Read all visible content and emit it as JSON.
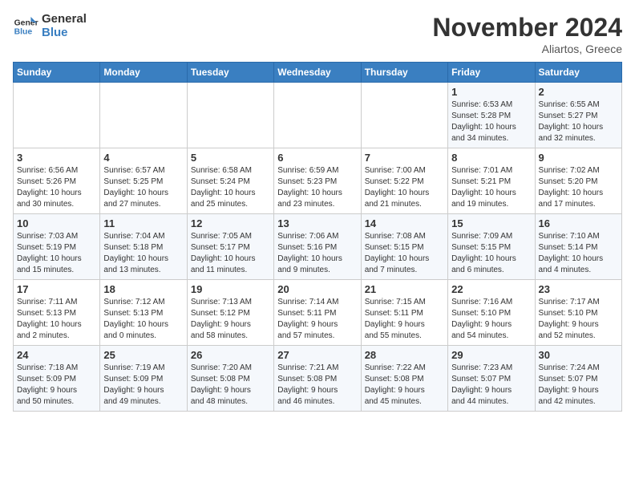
{
  "logo": {
    "line1": "General",
    "line2": "Blue"
  },
  "title": "November 2024",
  "subtitle": "Aliartos, Greece",
  "days_of_week": [
    "Sunday",
    "Monday",
    "Tuesday",
    "Wednesday",
    "Thursday",
    "Friday",
    "Saturday"
  ],
  "weeks": [
    [
      {
        "day": "",
        "info": ""
      },
      {
        "day": "",
        "info": ""
      },
      {
        "day": "",
        "info": ""
      },
      {
        "day": "",
        "info": ""
      },
      {
        "day": "",
        "info": ""
      },
      {
        "day": "1",
        "info": "Sunrise: 6:53 AM\nSunset: 5:28 PM\nDaylight: 10 hours\nand 34 minutes."
      },
      {
        "day": "2",
        "info": "Sunrise: 6:55 AM\nSunset: 5:27 PM\nDaylight: 10 hours\nand 32 minutes."
      }
    ],
    [
      {
        "day": "3",
        "info": "Sunrise: 6:56 AM\nSunset: 5:26 PM\nDaylight: 10 hours\nand 30 minutes."
      },
      {
        "day": "4",
        "info": "Sunrise: 6:57 AM\nSunset: 5:25 PM\nDaylight: 10 hours\nand 27 minutes."
      },
      {
        "day": "5",
        "info": "Sunrise: 6:58 AM\nSunset: 5:24 PM\nDaylight: 10 hours\nand 25 minutes."
      },
      {
        "day": "6",
        "info": "Sunrise: 6:59 AM\nSunset: 5:23 PM\nDaylight: 10 hours\nand 23 minutes."
      },
      {
        "day": "7",
        "info": "Sunrise: 7:00 AM\nSunset: 5:22 PM\nDaylight: 10 hours\nand 21 minutes."
      },
      {
        "day": "8",
        "info": "Sunrise: 7:01 AM\nSunset: 5:21 PM\nDaylight: 10 hours\nand 19 minutes."
      },
      {
        "day": "9",
        "info": "Sunrise: 7:02 AM\nSunset: 5:20 PM\nDaylight: 10 hours\nand 17 minutes."
      }
    ],
    [
      {
        "day": "10",
        "info": "Sunrise: 7:03 AM\nSunset: 5:19 PM\nDaylight: 10 hours\nand 15 minutes."
      },
      {
        "day": "11",
        "info": "Sunrise: 7:04 AM\nSunset: 5:18 PM\nDaylight: 10 hours\nand 13 minutes."
      },
      {
        "day": "12",
        "info": "Sunrise: 7:05 AM\nSunset: 5:17 PM\nDaylight: 10 hours\nand 11 minutes."
      },
      {
        "day": "13",
        "info": "Sunrise: 7:06 AM\nSunset: 5:16 PM\nDaylight: 10 hours\nand 9 minutes."
      },
      {
        "day": "14",
        "info": "Sunrise: 7:08 AM\nSunset: 5:15 PM\nDaylight: 10 hours\nand 7 minutes."
      },
      {
        "day": "15",
        "info": "Sunrise: 7:09 AM\nSunset: 5:15 PM\nDaylight: 10 hours\nand 6 minutes."
      },
      {
        "day": "16",
        "info": "Sunrise: 7:10 AM\nSunset: 5:14 PM\nDaylight: 10 hours\nand 4 minutes."
      }
    ],
    [
      {
        "day": "17",
        "info": "Sunrise: 7:11 AM\nSunset: 5:13 PM\nDaylight: 10 hours\nand 2 minutes."
      },
      {
        "day": "18",
        "info": "Sunrise: 7:12 AM\nSunset: 5:13 PM\nDaylight: 10 hours\nand 0 minutes."
      },
      {
        "day": "19",
        "info": "Sunrise: 7:13 AM\nSunset: 5:12 PM\nDaylight: 9 hours\nand 58 minutes."
      },
      {
        "day": "20",
        "info": "Sunrise: 7:14 AM\nSunset: 5:11 PM\nDaylight: 9 hours\nand 57 minutes."
      },
      {
        "day": "21",
        "info": "Sunrise: 7:15 AM\nSunset: 5:11 PM\nDaylight: 9 hours\nand 55 minutes."
      },
      {
        "day": "22",
        "info": "Sunrise: 7:16 AM\nSunset: 5:10 PM\nDaylight: 9 hours\nand 54 minutes."
      },
      {
        "day": "23",
        "info": "Sunrise: 7:17 AM\nSunset: 5:10 PM\nDaylight: 9 hours\nand 52 minutes."
      }
    ],
    [
      {
        "day": "24",
        "info": "Sunrise: 7:18 AM\nSunset: 5:09 PM\nDaylight: 9 hours\nand 50 minutes."
      },
      {
        "day": "25",
        "info": "Sunrise: 7:19 AM\nSunset: 5:09 PM\nDaylight: 9 hours\nand 49 minutes."
      },
      {
        "day": "26",
        "info": "Sunrise: 7:20 AM\nSunset: 5:08 PM\nDaylight: 9 hours\nand 48 minutes."
      },
      {
        "day": "27",
        "info": "Sunrise: 7:21 AM\nSunset: 5:08 PM\nDaylight: 9 hours\nand 46 minutes."
      },
      {
        "day": "28",
        "info": "Sunrise: 7:22 AM\nSunset: 5:08 PM\nDaylight: 9 hours\nand 45 minutes."
      },
      {
        "day": "29",
        "info": "Sunrise: 7:23 AM\nSunset: 5:07 PM\nDaylight: 9 hours\nand 44 minutes."
      },
      {
        "day": "30",
        "info": "Sunrise: 7:24 AM\nSunset: 5:07 PM\nDaylight: 9 hours\nand 42 minutes."
      }
    ]
  ]
}
